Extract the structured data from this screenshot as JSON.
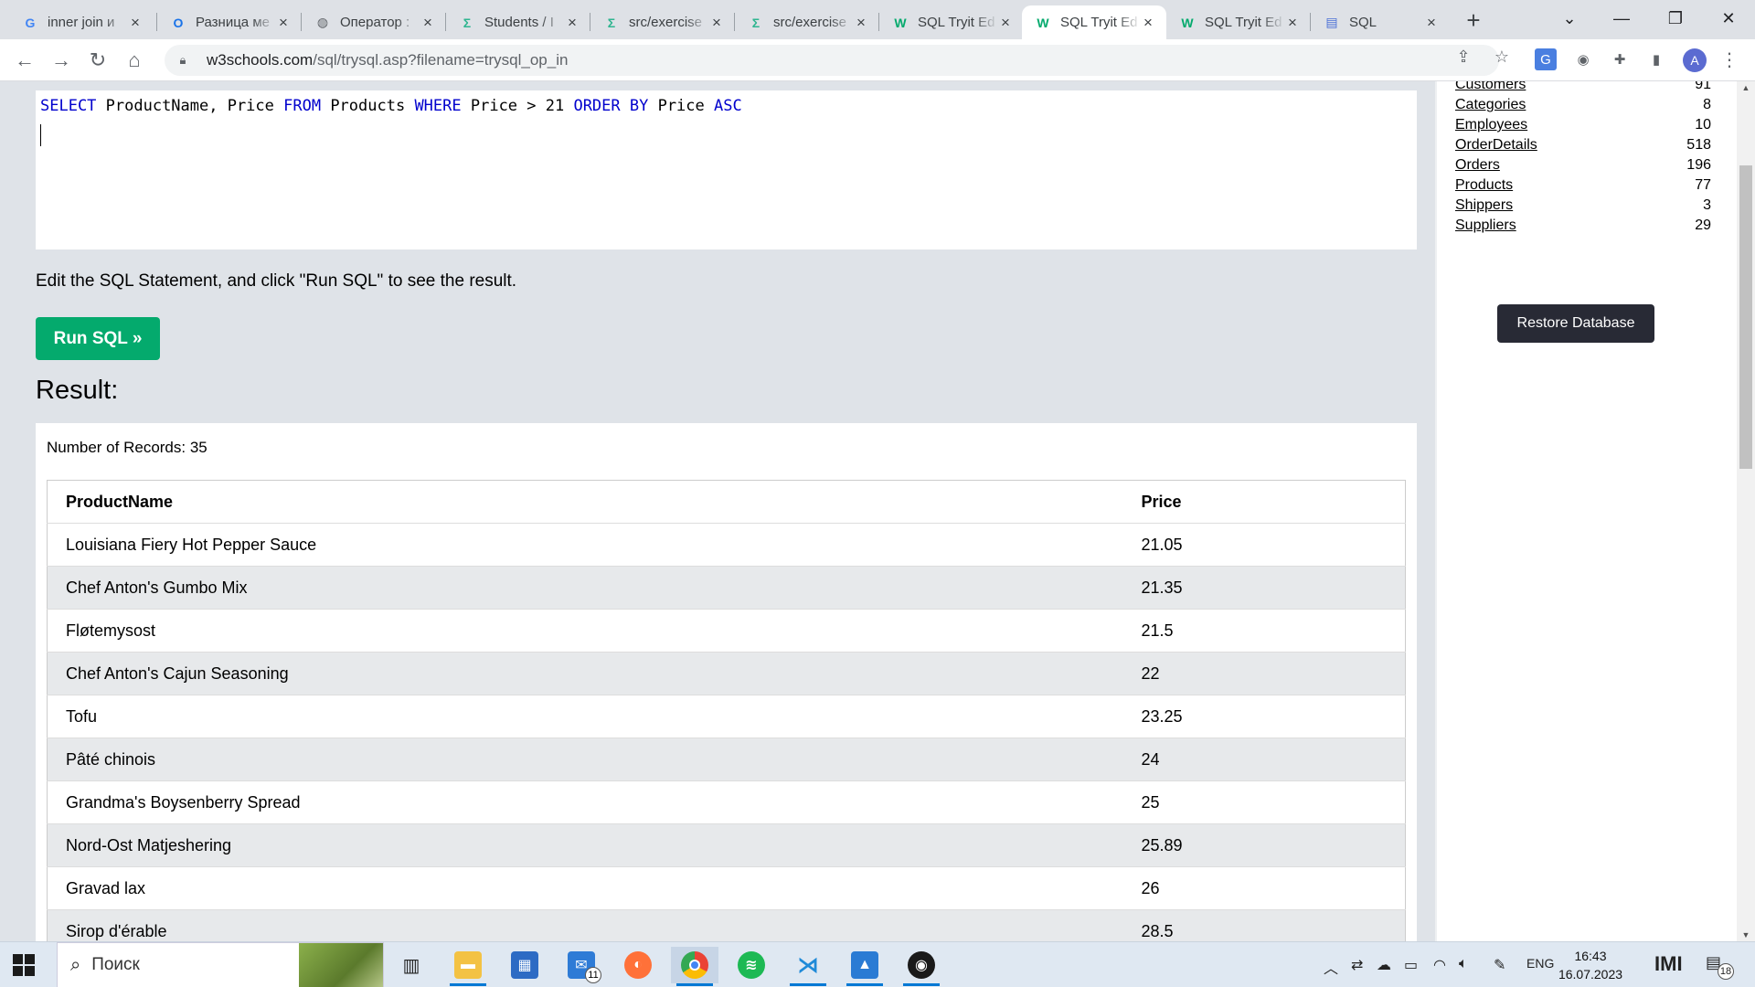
{
  "browser": {
    "tabs": [
      {
        "title": "inner join и",
        "icon": "google-icon",
        "icon_text": "G",
        "icon_color": "#4285f4"
      },
      {
        "title": "Разница ме",
        "icon": "opera-icon",
        "icon_text": "O",
        "icon_color": "#1a73e8"
      },
      {
        "title": "Оператор :",
        "icon": "globe-icon",
        "icon_text": "◍",
        "icon_color": "#5f6368"
      },
      {
        "title": "Students / I",
        "icon": "exercism-icon",
        "icon_text": "Σ",
        "icon_color": "#2fb590"
      },
      {
        "title": "src/exercise",
        "icon": "exercism-icon",
        "icon_text": "Σ",
        "icon_color": "#2fb590"
      },
      {
        "title": "src/exercise",
        "icon": "exercism-icon",
        "icon_text": "Σ",
        "icon_color": "#2fb590"
      },
      {
        "title": "SQL Tryit Ed",
        "icon": "w3schools-icon",
        "icon_text": "W",
        "icon_color": "#04aa6d"
      },
      {
        "title": "SQL Tryit Ed",
        "icon": "w3schools-icon",
        "icon_text": "W",
        "icon_color": "#04aa6d",
        "active": true
      },
      {
        "title": "SQL Tryit Ed",
        "icon": "w3schools-icon",
        "icon_text": "W",
        "icon_color": "#04aa6d"
      },
      {
        "title": "SQL",
        "icon": "document-icon",
        "icon_text": "▤",
        "icon_color": "#4a6fd6"
      }
    ],
    "url_host": "w3schools.com",
    "url_path": "/sql/trysql.asp?filename=trysql_op_in",
    "profile_initial": "A"
  },
  "editor": {
    "sql_tokens": [
      {
        "t": "SELECT",
        "kw": true
      },
      {
        "t": " ProductName, Price ",
        "kw": false
      },
      {
        "t": "FROM",
        "kw": true
      },
      {
        "t": " Products ",
        "kw": false
      },
      {
        "t": "WHERE",
        "kw": true
      },
      {
        "t": " Price > 21 ",
        "kw": false
      },
      {
        "t": "ORDER BY",
        "kw": true
      },
      {
        "t": " Price ",
        "kw": false
      },
      {
        "t": "ASC",
        "kw": true
      }
    ]
  },
  "main": {
    "hint": "Edit the SQL Statement, and click \"Run SQL\" to see the result.",
    "run_button": "Run SQL »",
    "result_heading": "Result:",
    "record_count": "Number of Records: 35",
    "columns": [
      "ProductName",
      "Price"
    ],
    "rows": [
      [
        "Louisiana Fiery Hot Pepper Sauce",
        "21.05"
      ],
      [
        "Chef Anton's Gumbo Mix",
        "21.35"
      ],
      [
        "Fløtemysost",
        "21.5"
      ],
      [
        "Chef Anton's Cajun Seasoning",
        "22"
      ],
      [
        "Tofu",
        "23.25"
      ],
      [
        "Pâté chinois",
        "24"
      ],
      [
        "Grandma's Boysenberry Spread",
        "25"
      ],
      [
        "Nord-Ost Matjeshering",
        "25.89"
      ],
      [
        "Gravad lax",
        "26"
      ],
      [
        "Sirop d'érable",
        "28.5"
      ]
    ]
  },
  "database": {
    "tables": [
      {
        "name": "Customers",
        "count": "91"
      },
      {
        "name": "Categories",
        "count": "8"
      },
      {
        "name": "Employees",
        "count": "10"
      },
      {
        "name": "OrderDetails",
        "count": "518"
      },
      {
        "name": "Orders",
        "count": "196"
      },
      {
        "name": "Products",
        "count": "77"
      },
      {
        "name": "Shippers",
        "count": "3"
      },
      {
        "name": "Suppliers",
        "count": "29"
      }
    ],
    "restore_button": "Restore Database"
  },
  "taskbar": {
    "search_placeholder": "Поиск",
    "mail_badge": "11",
    "language": "ENG",
    "time": "16:43",
    "date": "16.07.2023",
    "notification_count": "18"
  }
}
